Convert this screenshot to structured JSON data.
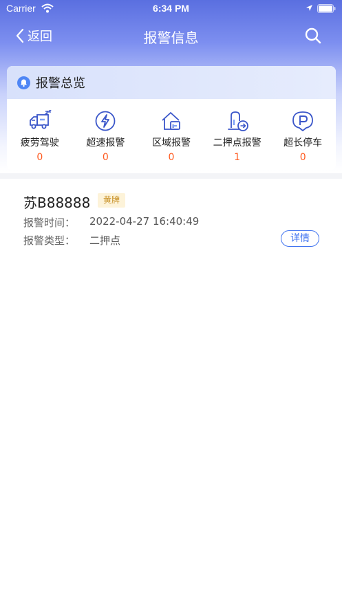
{
  "status_bar": {
    "carrier": "Carrier",
    "time": "6:34 PM"
  },
  "nav": {
    "back_label": "返回",
    "title": "报警信息"
  },
  "overview": {
    "title": "报警总览",
    "stats": [
      {
        "label": "疲劳驾驶",
        "count": "0",
        "icon": "fatigue-truck-icon"
      },
      {
        "label": "超速报警",
        "count": "0",
        "icon": "lightning-icon"
      },
      {
        "label": "区域报警",
        "count": "0",
        "icon": "house-zone-icon"
      },
      {
        "label": "二押点报警",
        "count": "1",
        "icon": "pledge-point-icon"
      },
      {
        "label": "超长停车",
        "count": "0",
        "icon": "parking-icon"
      }
    ]
  },
  "records": [
    {
      "plate": "苏B88888",
      "badge": "黄牌",
      "time_label": "报警时间：",
      "time_value": "2022-04-27 16:40:49",
      "type_label": "报警类型：",
      "type_value": "二押点",
      "detail_label": "详情"
    }
  ],
  "colors": {
    "accent": "#3f73f0",
    "count": "#ff5a1f",
    "header": "#5a6fe0",
    "badge_bg": "#fdf3d9"
  }
}
